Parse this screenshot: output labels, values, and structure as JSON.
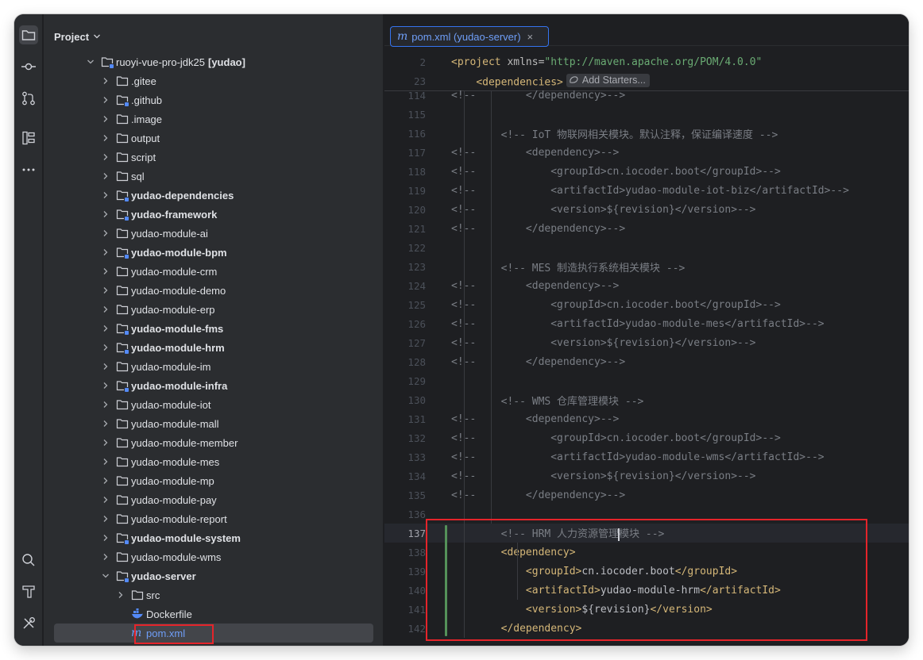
{
  "project_panel": {
    "title": "Project",
    "root": {
      "name": "ruoyi-vue-pro-jdk25",
      "module": "[yudao]"
    },
    "items": [
      {
        "label": ".gitee",
        "bold": false,
        "module": false,
        "depth": 1
      },
      {
        "label": ".github",
        "bold": false,
        "module": true,
        "depth": 1
      },
      {
        "label": ".image",
        "bold": false,
        "module": false,
        "depth": 1
      },
      {
        "label": "output",
        "bold": false,
        "module": false,
        "depth": 1
      },
      {
        "label": "script",
        "bold": false,
        "module": false,
        "depth": 1
      },
      {
        "label": "sql",
        "bold": false,
        "module": false,
        "depth": 1
      },
      {
        "label": "yudao-dependencies",
        "bold": true,
        "module": true,
        "depth": 1
      },
      {
        "label": "yudao-framework",
        "bold": true,
        "module": true,
        "depth": 1
      },
      {
        "label": "yudao-module-ai",
        "bold": false,
        "module": false,
        "depth": 1
      },
      {
        "label": "yudao-module-bpm",
        "bold": true,
        "module": true,
        "depth": 1
      },
      {
        "label": "yudao-module-crm",
        "bold": false,
        "module": false,
        "depth": 1
      },
      {
        "label": "yudao-module-demo",
        "bold": false,
        "module": false,
        "depth": 1
      },
      {
        "label": "yudao-module-erp",
        "bold": false,
        "module": false,
        "depth": 1
      },
      {
        "label": "yudao-module-fms",
        "bold": true,
        "module": true,
        "depth": 1
      },
      {
        "label": "yudao-module-hrm",
        "bold": true,
        "module": true,
        "depth": 1
      },
      {
        "label": "yudao-module-im",
        "bold": false,
        "module": false,
        "depth": 1
      },
      {
        "label": "yudao-module-infra",
        "bold": true,
        "module": true,
        "depth": 1
      },
      {
        "label": "yudao-module-iot",
        "bold": false,
        "module": false,
        "depth": 1
      },
      {
        "label": "yudao-module-mall",
        "bold": false,
        "module": false,
        "depth": 1
      },
      {
        "label": "yudao-module-member",
        "bold": false,
        "module": false,
        "depth": 1
      },
      {
        "label": "yudao-module-mes",
        "bold": false,
        "module": false,
        "depth": 1
      },
      {
        "label": "yudao-module-mp",
        "bold": false,
        "module": false,
        "depth": 1
      },
      {
        "label": "yudao-module-pay",
        "bold": false,
        "module": false,
        "depth": 1
      },
      {
        "label": "yudao-module-report",
        "bold": false,
        "module": false,
        "depth": 1
      },
      {
        "label": "yudao-module-system",
        "bold": true,
        "module": true,
        "depth": 1
      },
      {
        "label": "yudao-module-wms",
        "bold": false,
        "module": false,
        "depth": 1
      }
    ],
    "server": {
      "label": "yudao-server",
      "src": "src",
      "dockerfile": "Dockerfile",
      "pom": "pom.xml"
    }
  },
  "editor": {
    "tab_label": "pom.xml (yudao-server)",
    "tab_icon": "m",
    "close_glyph": "×",
    "add_starters": "Add Starters...",
    "sticky": [
      {
        "num": "2",
        "indent": 0,
        "open": "<project ",
        "attr": "xmlns=",
        "str": "\"http://maven.apache.org/POM/4.0.0\"",
        "close": ""
      },
      {
        "num": "23",
        "indent": 4,
        "open": "<dependencies>",
        "attr": "",
        "str": "",
        "close": ""
      }
    ],
    "lines": [
      {
        "num": "114",
        "text": "<!--        </dependency>-->"
      },
      {
        "num": "115",
        "text": ""
      },
      {
        "num": "116",
        "text": "        <!-- IoT 物联网相关模块。默认注释，保证编译速度 -->"
      },
      {
        "num": "117",
        "text": "<!--        <dependency>-->"
      },
      {
        "num": "118",
        "text": "<!--            <groupId>cn.iocoder.boot</groupId>-->"
      },
      {
        "num": "119",
        "text": "<!--            <artifactId>yudao-module-iot-biz</artifactId>-->"
      },
      {
        "num": "120",
        "text": "<!--            <version>${revision}</version>-->"
      },
      {
        "num": "121",
        "text": "<!--        </dependency>-->"
      },
      {
        "num": "122",
        "text": ""
      },
      {
        "num": "123",
        "text": "        <!-- MES 制造执行系统相关模块 -->"
      },
      {
        "num": "124",
        "text": "<!--        <dependency>-->"
      },
      {
        "num": "125",
        "text": "<!--            <groupId>cn.iocoder.boot</groupId>-->"
      },
      {
        "num": "126",
        "text": "<!--            <artifactId>yudao-module-mes</artifactId>-->"
      },
      {
        "num": "127",
        "text": "<!--            <version>${revision}</version>-->"
      },
      {
        "num": "128",
        "text": "<!--        </dependency>-->"
      },
      {
        "num": "129",
        "text": ""
      },
      {
        "num": "130",
        "text": "        <!-- WMS 仓库管理模块 -->"
      },
      {
        "num": "131",
        "text": "<!--        <dependency>-->"
      },
      {
        "num": "132",
        "text": "<!--            <groupId>cn.iocoder.boot</groupId>-->"
      },
      {
        "num": "133",
        "text": "<!--            <artifactId>yudao-module-wms</artifactId>-->"
      },
      {
        "num": "134",
        "text": "<!--            <version>${revision}</version>-->"
      },
      {
        "num": "135",
        "text": "<!--        </dependency>-->"
      },
      {
        "num": "136",
        "text": ""
      }
    ],
    "new_lines": [
      {
        "num": "137",
        "parts": [
          [
            "cmt",
            "        <!-- HRM 人力资源管理"
          ],
          [
            "caret",
            ""
          ],
          [
            "cmt",
            "模块 -->"
          ]
        ]
      },
      {
        "num": "138",
        "parts": [
          [
            "tag",
            "        <dependency>"
          ]
        ]
      },
      {
        "num": "139",
        "parts": [
          [
            "tag",
            "            <groupId>"
          ],
          [
            "plain",
            "cn.iocoder.boot"
          ],
          [
            "tag",
            "</groupId>"
          ]
        ]
      },
      {
        "num": "140",
        "parts": [
          [
            "tag",
            "            <artifactId>"
          ],
          [
            "plain",
            "yudao-module-hrm"
          ],
          [
            "tag",
            "</artifactId>"
          ]
        ]
      },
      {
        "num": "141",
        "parts": [
          [
            "tag",
            "            <version>"
          ],
          [
            "plain",
            "${revision}"
          ],
          [
            "tag",
            "</version>"
          ]
        ]
      },
      {
        "num": "142",
        "parts": [
          [
            "tag",
            "        </dependency>"
          ]
        ]
      }
    ],
    "current_line": "137"
  },
  "colors": {
    "accent": "#3574f0",
    "highlight_box": "#e5242a",
    "change_marker": "#549159",
    "xml_tag": "#d5b778",
    "comment": "#7a7e85"
  },
  "icons": {
    "strip": [
      "folder-icon",
      "commit-icon",
      "pull-request-icon",
      "structure-icon",
      "more-icon",
      "search-icon",
      "build-icon",
      "tools-icon"
    ]
  }
}
